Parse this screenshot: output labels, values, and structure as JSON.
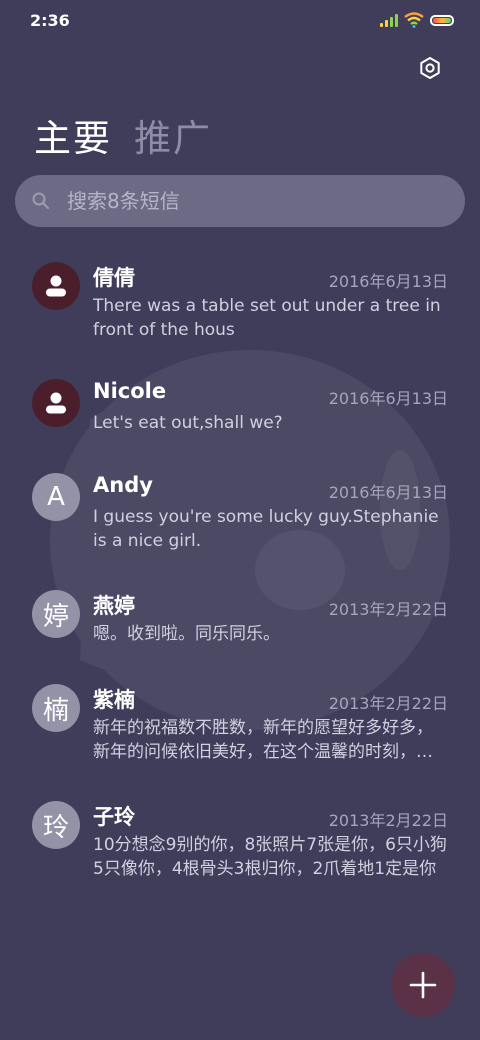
{
  "status_bar": {
    "time": "2:36",
    "icons": [
      "signal-icon",
      "wifi-icon",
      "battery-icon"
    ]
  },
  "header": {
    "settings_icon": "gear-icon"
  },
  "tabs": [
    {
      "label": "主要",
      "active": true
    },
    {
      "label": "推广",
      "active": false
    }
  ],
  "search": {
    "placeholder": "搜索8条短信",
    "icon": "search-icon"
  },
  "conversations": [
    {
      "avatar_text": "",
      "avatar_icon": "person-icon",
      "name": "倩倩",
      "date": "2016年6月13日",
      "snippet": "There was a table set out under a tree in front of the hous"
    },
    {
      "avatar_text": "",
      "avatar_icon": "person-icon",
      "name": "Nicole",
      "date": "2016年6月13日",
      "snippet": "Let's eat out,shall we?"
    },
    {
      "avatar_text": "A",
      "name": "Andy",
      "date": "2016年6月13日",
      "snippet": "I guess you're some lucky guy.Stephanie is a nice girl."
    },
    {
      "avatar_text": "婷",
      "name": "燕婷",
      "date": "2013年2月22日",
      "snippet": "嗯。收到啦。同乐同乐。"
    },
    {
      "avatar_text": "楠",
      "name": "紫楠",
      "date": "2013年2月22日",
      "snippet": "新年的祝福数不胜数，新年的愿望好多好多，新年的问候依旧美好，在这个温馨的时刻，祝你新年快乐"
    },
    {
      "avatar_text": "玲",
      "name": "子玲",
      "date": "2013年2月22日",
      "snippet": "10分想念9别的你，8张照片7张是你，6只小狗5只像你，4根骨头3根归你，2爪着地1定是你"
    }
  ],
  "fab": {
    "icon": "plus-icon"
  },
  "colors": {
    "background": "#3f3d5a",
    "search_bg": "#6c6a85",
    "avatar_dark": "#4b1e2c",
    "avatar_light": "#9492a7",
    "fab": "#5b3147"
  }
}
